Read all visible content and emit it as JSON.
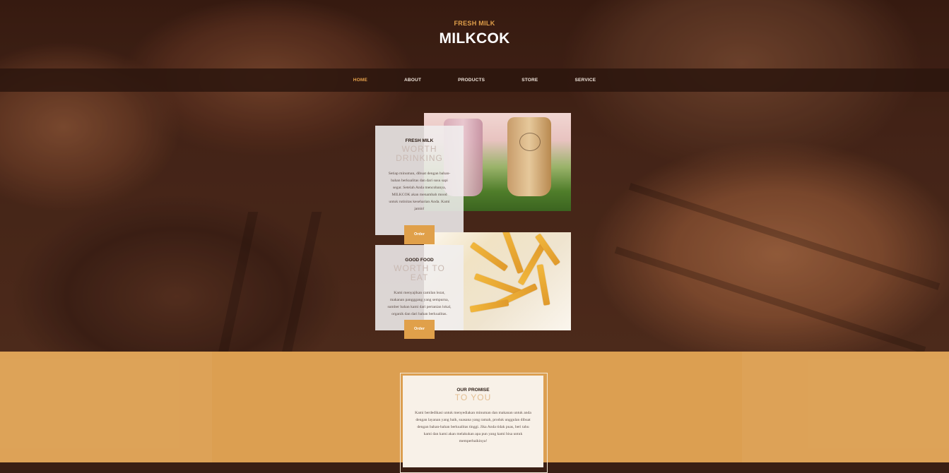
{
  "header": {
    "subtitle": "FRESH MILK",
    "title": "MILKCOK"
  },
  "nav": {
    "items": [
      "HOME",
      "ABOUT",
      "PRODUCTS",
      "STORE",
      "SERVICE"
    ],
    "active": "HOME"
  },
  "featured": [
    {
      "eyebrow": "FRESH MILK",
      "headline": "WORTH DRINKING",
      "body": "Setiap minuman, dibuat dengan bahan-bahan berkualitas dan dari susu sapi segar. Setelah Anda mencobanya, MILKCOK akan menambah mood untuk rutinitas keseharian Anda. Kami jamin!",
      "button": "Order",
      "image": "milk-tea-cups-photo"
    },
    {
      "eyebrow": "GOOD FOOD",
      "headline": "WORTH TO EAT",
      "body": "Kami menyajikan camilan lezat, makanan pangggang yang sempurna, sumber bahan kami dari pertanian lokal, organik dan dari bahan berkualitas.",
      "button": "Order",
      "image": "french-fries-photo"
    }
  ],
  "promise": {
    "eyebrow": "OUR PROMISE",
    "headline": "TO YOU",
    "body": "Kami berdedikasi untuk menyediakan minuman dan makanan untuk anda dengan layanan yang baik, suasana yang ramah, produk unggulan dibuat dengan bahan-bahan berkualitas tinggi. Jika Anda tidak puas, beri tahu kami dan kami akan melakukan apa pun yang kami bisa untuk memperbaikinya!"
  },
  "colors": {
    "accent": "#e0a04a",
    "promise_band": "#dc9f51",
    "nav_background": "#2c160e",
    "card_background": "#f0eeee"
  }
}
